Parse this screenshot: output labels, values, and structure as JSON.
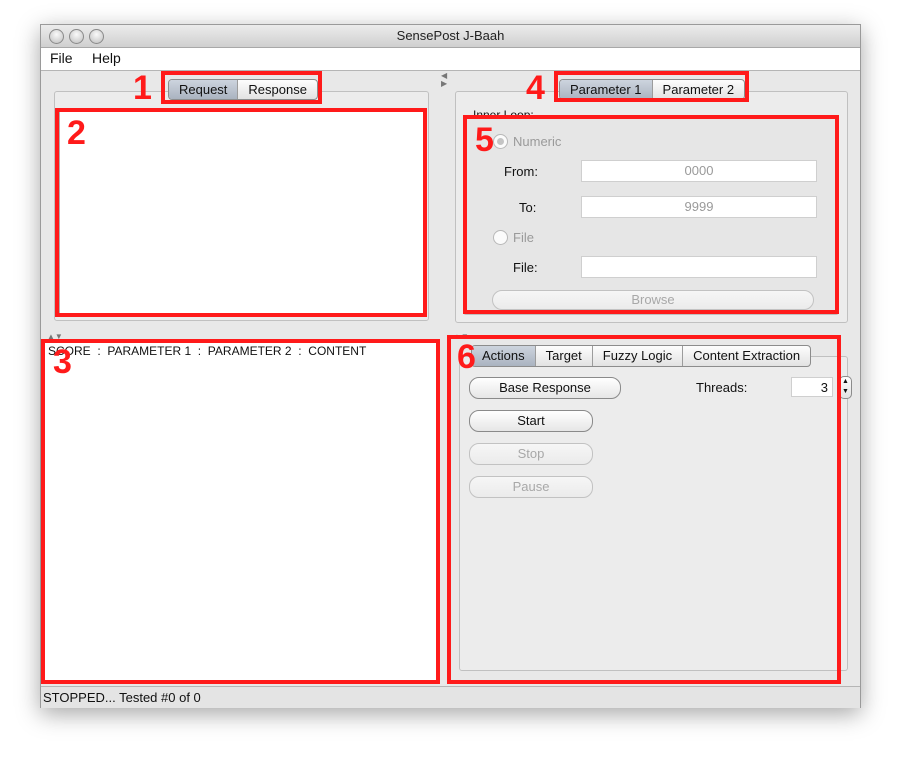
{
  "window": {
    "title": "SensePost J-Baah"
  },
  "menu": {
    "file": "File",
    "help": "Help"
  },
  "left": {
    "tabs": [
      {
        "label": "Request",
        "selected": true
      },
      {
        "label": "Response",
        "selected": false
      }
    ],
    "results_header": "SCORE  :  PARAMETER 1  :  PARAMETER 2  :  CONTENT"
  },
  "right": {
    "param_tabs": [
      {
        "label": "Parameter 1",
        "selected": true
      },
      {
        "label": "Parameter 2",
        "selected": false
      }
    ],
    "inner_loop": {
      "group_label": "Inner Loop:",
      "numeric_label": "Numeric",
      "from_label": "From:",
      "from_value": "0000",
      "to_label": "To:",
      "to_value": "9999",
      "file_radio_label": "File",
      "file_label": "File:",
      "file_value": "",
      "browse_label": "Browse"
    },
    "action_tabs": [
      {
        "label": "Actions",
        "selected": true
      },
      {
        "label": "Target",
        "selected": false
      },
      {
        "label": "Fuzzy Logic",
        "selected": false
      },
      {
        "label": "Content Extraction",
        "selected": false
      }
    ],
    "actions": {
      "base_response": "Base Response",
      "start": "Start",
      "stop": "Stop",
      "pause": "Pause",
      "threads_label": "Threads:",
      "threads_value": "3"
    }
  },
  "status": {
    "text": "STOPPED... Tested #0 of 0"
  },
  "annotations": {
    "box1": "1",
    "box2": "2",
    "box3": "3",
    "box4": "4",
    "box5": "5",
    "box6": "6",
    "color": "#ff1a1a"
  },
  "icons": [
    "window-close-icon",
    "window-minimize-icon",
    "window-zoom-icon",
    "radio-numeric-icon",
    "radio-file-icon",
    "stepper-icon"
  ]
}
